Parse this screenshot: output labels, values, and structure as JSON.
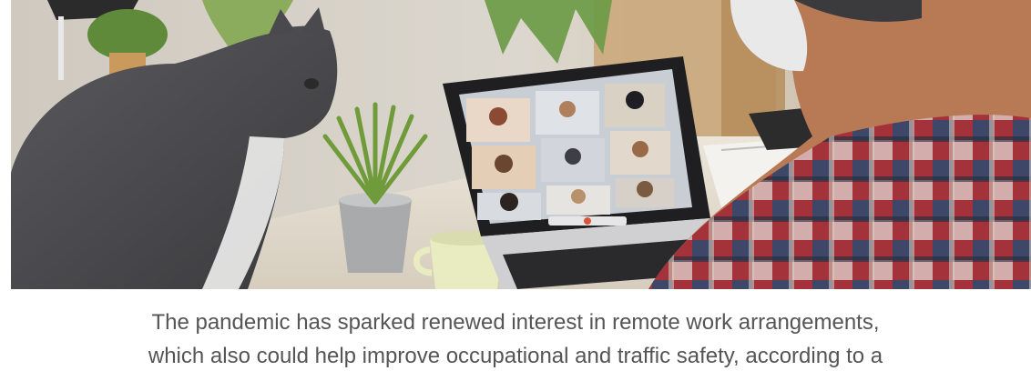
{
  "article": {
    "caption": {
      "lines": [
        "The pandemic has sparked renewed interest in remote work arrangements,",
        "which also could help improve occupational and traffic safety, according to a"
      ]
    }
  },
  "photo": {
    "colors": {
      "wall": "#d9d4cb",
      "desk": "#e4ddd0",
      "cat": "#4b4b4e",
      "laptop": "#1f1f22",
      "screen": "#c9cdd4",
      "plant": "#6f9b3a",
      "pot": "#a9aaac",
      "cup": "#e8ecc0",
      "shirt_red": "#a3323a",
      "shirt_blue": "#2d4b6e",
      "headphones": "#e9e9ea"
    }
  }
}
